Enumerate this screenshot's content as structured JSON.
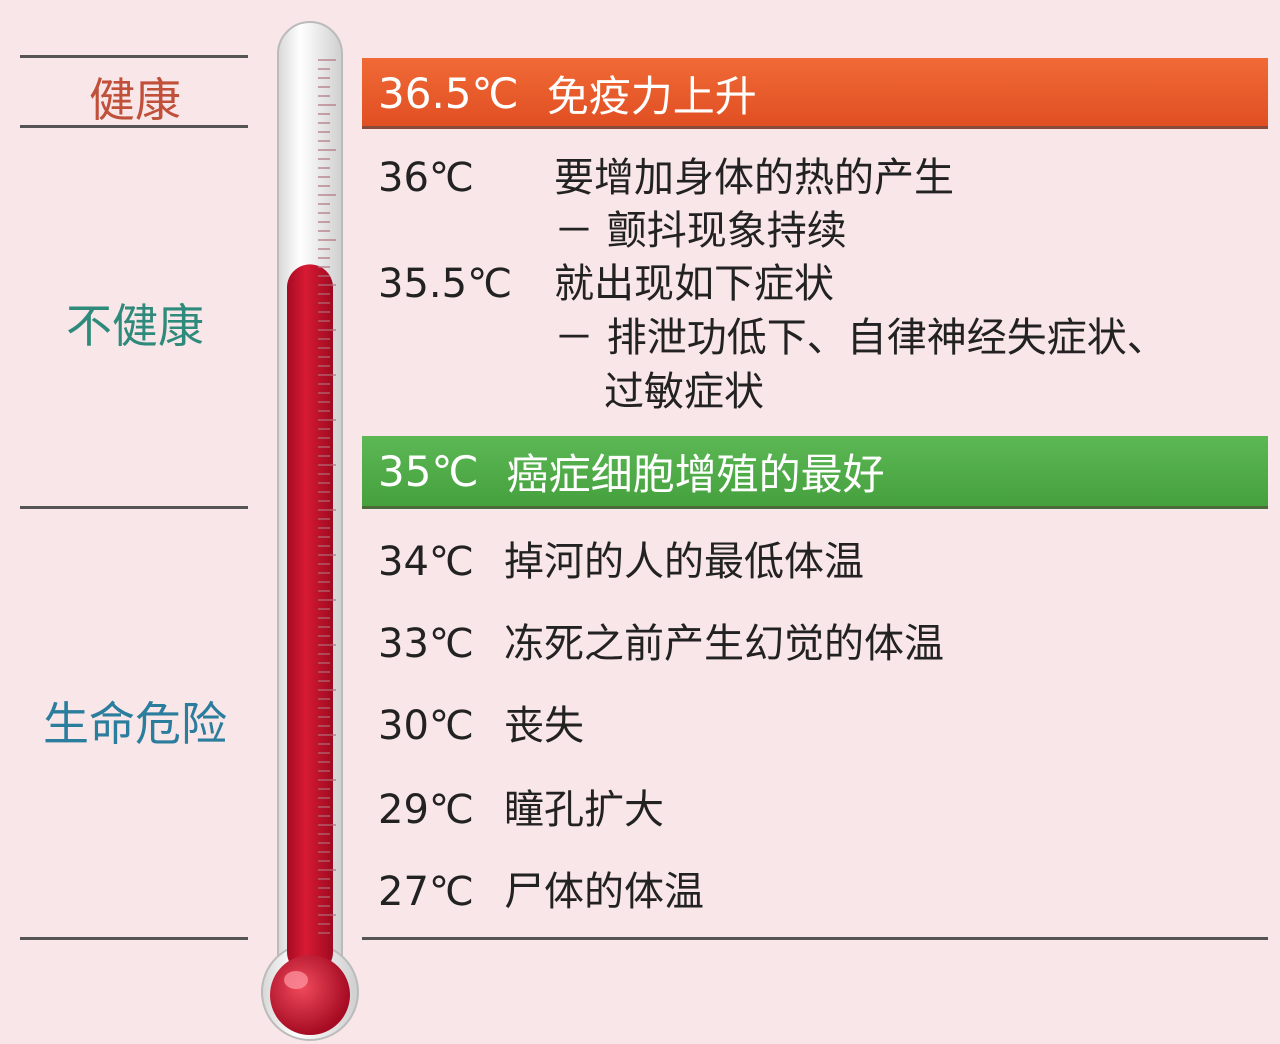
{
  "zones": {
    "healthy": {
      "label": "健康",
      "color": "#c0503a"
    },
    "unhealthy": {
      "label": "不健康",
      "color": "#2e8a7a"
    },
    "danger": {
      "label": "生命危险",
      "color": "#2a7d9c"
    }
  },
  "bands": {
    "top": {
      "temp": "36.5℃",
      "text": "免疫力上升",
      "color": "#e8582a"
    },
    "mid": {
      "temp": "35℃",
      "text": "癌症细胞增殖的最好",
      "color": "#4eaa48"
    }
  },
  "entries": {
    "t36": {
      "temp": "36℃",
      "text": "要增加身体的热的产生",
      "sub": "－ 颤抖现象持续"
    },
    "t355": {
      "temp": "35.5℃",
      "text": "就出现如下症状",
      "sub1": "－ 排泄功低下、自律神经失症状、",
      "sub2": "过敏症状"
    },
    "t34": {
      "temp": "34℃",
      "text": "掉河的人的最低体温"
    },
    "t33": {
      "temp": "33℃",
      "text": "冻死之前产生幻觉的体温"
    },
    "t30": {
      "temp": "30℃",
      "text": "丧失"
    },
    "t29": {
      "temp": "29℃",
      "text": "瞳孔扩大"
    },
    "t27": {
      "temp": "27℃",
      "text": "尸体的体温"
    }
  },
  "thermometer": {
    "fill_level": 0.76,
    "liquid_color": "#c8102e"
  }
}
